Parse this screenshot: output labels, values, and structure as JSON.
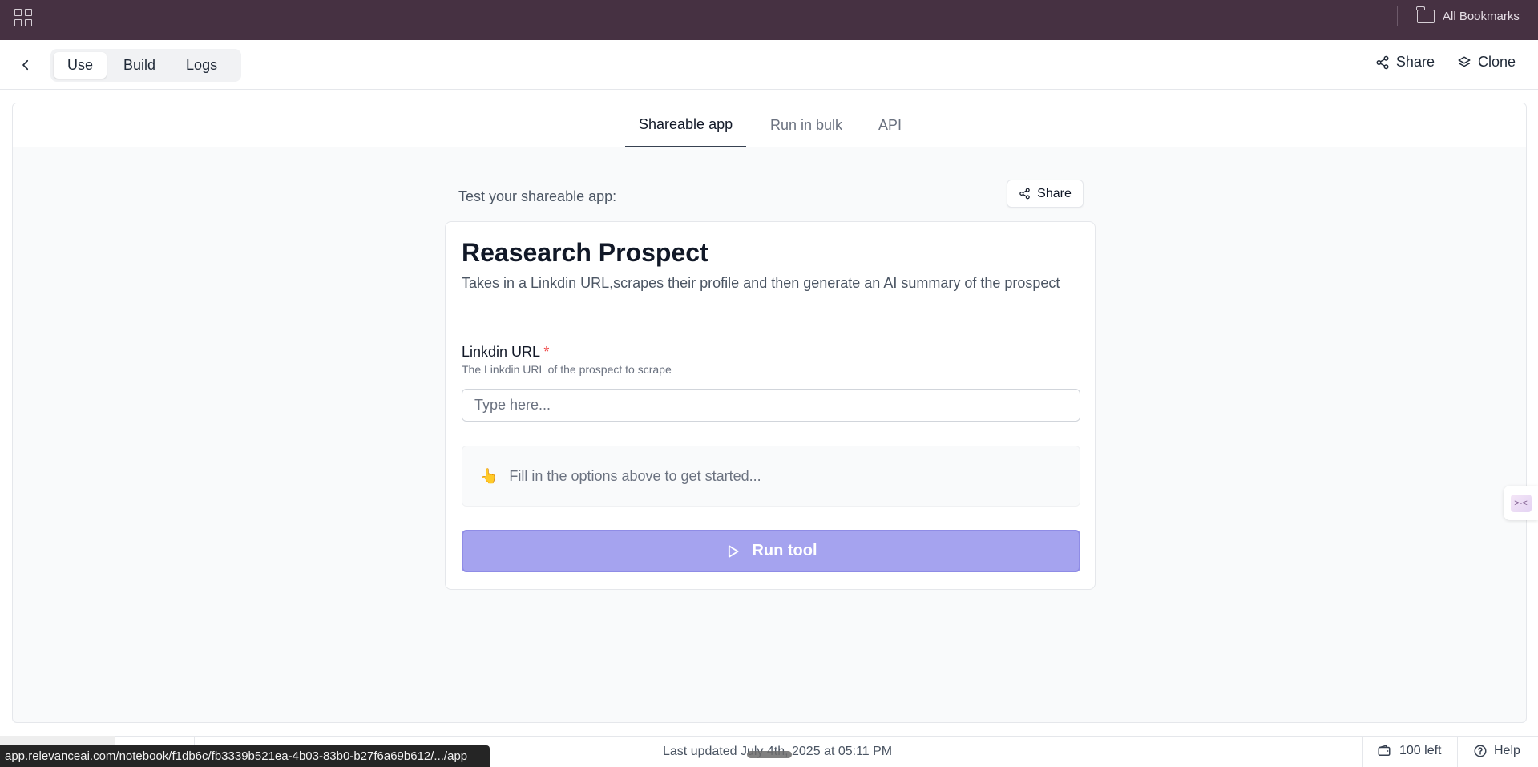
{
  "browser": {
    "bookmarks_label": "All Bookmarks"
  },
  "header": {
    "tabs": [
      {
        "label": "Use",
        "active": true
      },
      {
        "label": "Build",
        "active": false
      },
      {
        "label": "Logs",
        "active": false
      }
    ],
    "share_label": "Share",
    "clone_label": "Clone"
  },
  "subtabs": [
    {
      "label": "Shareable app",
      "active": true
    },
    {
      "label": "Run in bulk",
      "active": false
    },
    {
      "label": "API",
      "active": false
    }
  ],
  "main": {
    "test_label": "Test your shareable app:",
    "share_label": "Share",
    "card": {
      "title": "Reasearch Prospect",
      "description": "Takes in a Linkdin URL,scrapes their profile and then generate an AI summary of the prospect",
      "field": {
        "label": "Linkdin URL",
        "required_mark": "*",
        "help": "The Linkdin URL of the prospect to scrape",
        "placeholder": "Type here...",
        "value": ""
      },
      "hint_emoji": "👆",
      "hint": "Fill in the options above to get started...",
      "run_label": "Run tool"
    }
  },
  "footer": {
    "last_updated": "Last updated July 4th, 2025 at 05:11 PM",
    "credits": "100 left",
    "help": "Help"
  },
  "status_url": "app.relevanceai.com/notebook/f1db6c/fb3339b521ea-4b03-83b0-b27f6a69b612/.../app",
  "colors": {
    "browser_bar": "#463142",
    "run_button": "#a5a3ef",
    "required": "#ef4444"
  }
}
